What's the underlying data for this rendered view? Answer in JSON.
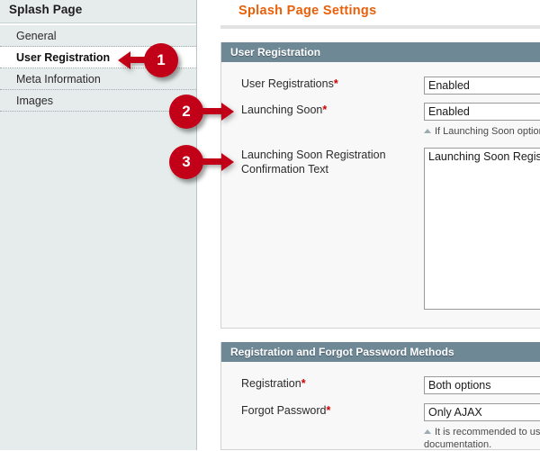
{
  "sidebar": {
    "title": "Splash Page",
    "items": [
      {
        "label": "General",
        "selected": false
      },
      {
        "label": "User Registration",
        "selected": true
      },
      {
        "label": "Meta Information",
        "selected": false
      },
      {
        "label": "Images",
        "selected": false
      }
    ]
  },
  "content": {
    "page_title": "Splash Page Settings",
    "fieldsets": [
      {
        "legend": "User Registration",
        "fields": [
          {
            "label": "User Registrations",
            "required_marker": "*",
            "control": "select",
            "value": "Enabled",
            "hint": ""
          },
          {
            "label": "Launching Soon",
            "required_marker": "*",
            "control": "select",
            "value": "Enabled",
            "hint": "If Launching Soon option"
          },
          {
            "label": "Launching Soon Registration Confirmation Text",
            "required_marker": "",
            "control": "textarea",
            "value": "Launching Soon Regis",
            "hint": ""
          }
        ]
      },
      {
        "legend": "Registration and Forgot Password Methods",
        "fields": [
          {
            "label": "Registration",
            "required_marker": "*",
            "control": "select",
            "value": "Both options",
            "hint": ""
          },
          {
            "label": "Forgot Password",
            "required_marker": "*",
            "control": "select",
            "value": "Only AJAX",
            "hint": "It is recommended to us documentation."
          }
        ]
      }
    ]
  },
  "callouts": [
    {
      "number": "1",
      "direction": "left"
    },
    {
      "number": "2",
      "direction": "right"
    },
    {
      "number": "3",
      "direction": "right"
    }
  ],
  "colors": {
    "title_orange": "#e8600a",
    "legend_slate": "#6e8896",
    "callout_red": "#c20017",
    "sidebar_bg": "#e6eceb",
    "required_red": "#d00000"
  }
}
